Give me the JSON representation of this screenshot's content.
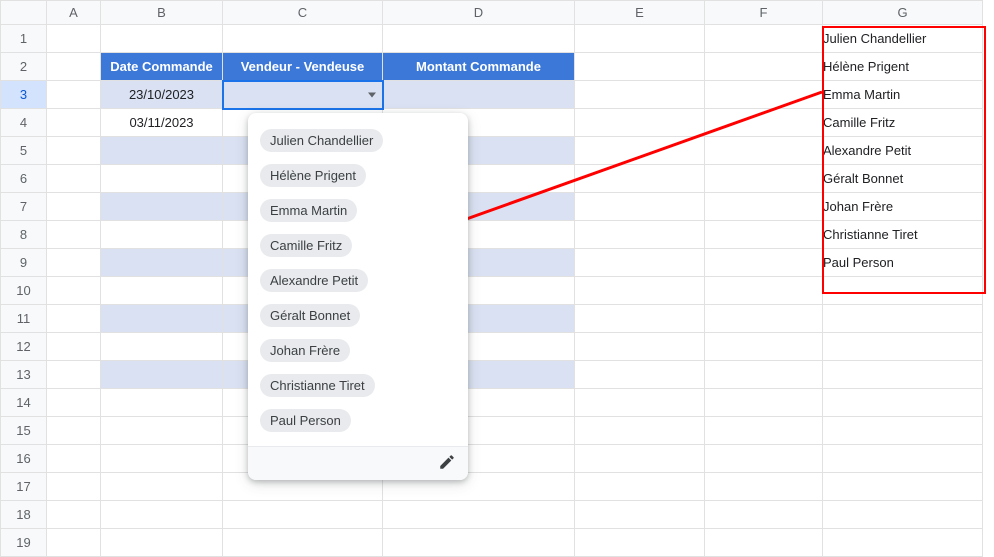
{
  "columns": [
    "A",
    "B",
    "C",
    "D",
    "E",
    "F",
    "G"
  ],
  "row_count": 19,
  "active_row": 3,
  "headers": {
    "b": "Date Commande",
    "c": "Vendeur - Vendeuse",
    "d": "Montant Commande"
  },
  "table_rows": [
    {
      "date": "23/10/2023"
    },
    {
      "date": "03/11/2023"
    }
  ],
  "banded_range_rows": [
    3,
    4,
    5,
    6,
    7,
    8,
    9,
    10,
    11,
    12,
    13
  ],
  "names_list": [
    "Julien Chandellier",
    "Hélène Prigent",
    "Emma Martin",
    "Camille Fritz",
    "Alexandre Petit",
    "Géralt Bonnet",
    "Johan Frère",
    "Christianne Tiret",
    "Paul Person"
  ],
  "dropdown": {
    "options": [
      "Julien Chandellier",
      "Hélène Prigent",
      "Emma Martin",
      "Camille Fritz",
      "Alexandre Petit",
      "Géralt Bonnet",
      "Johan Frère",
      "Christianne Tiret",
      "Paul Person"
    ],
    "edit_icon": "pencil-icon"
  }
}
